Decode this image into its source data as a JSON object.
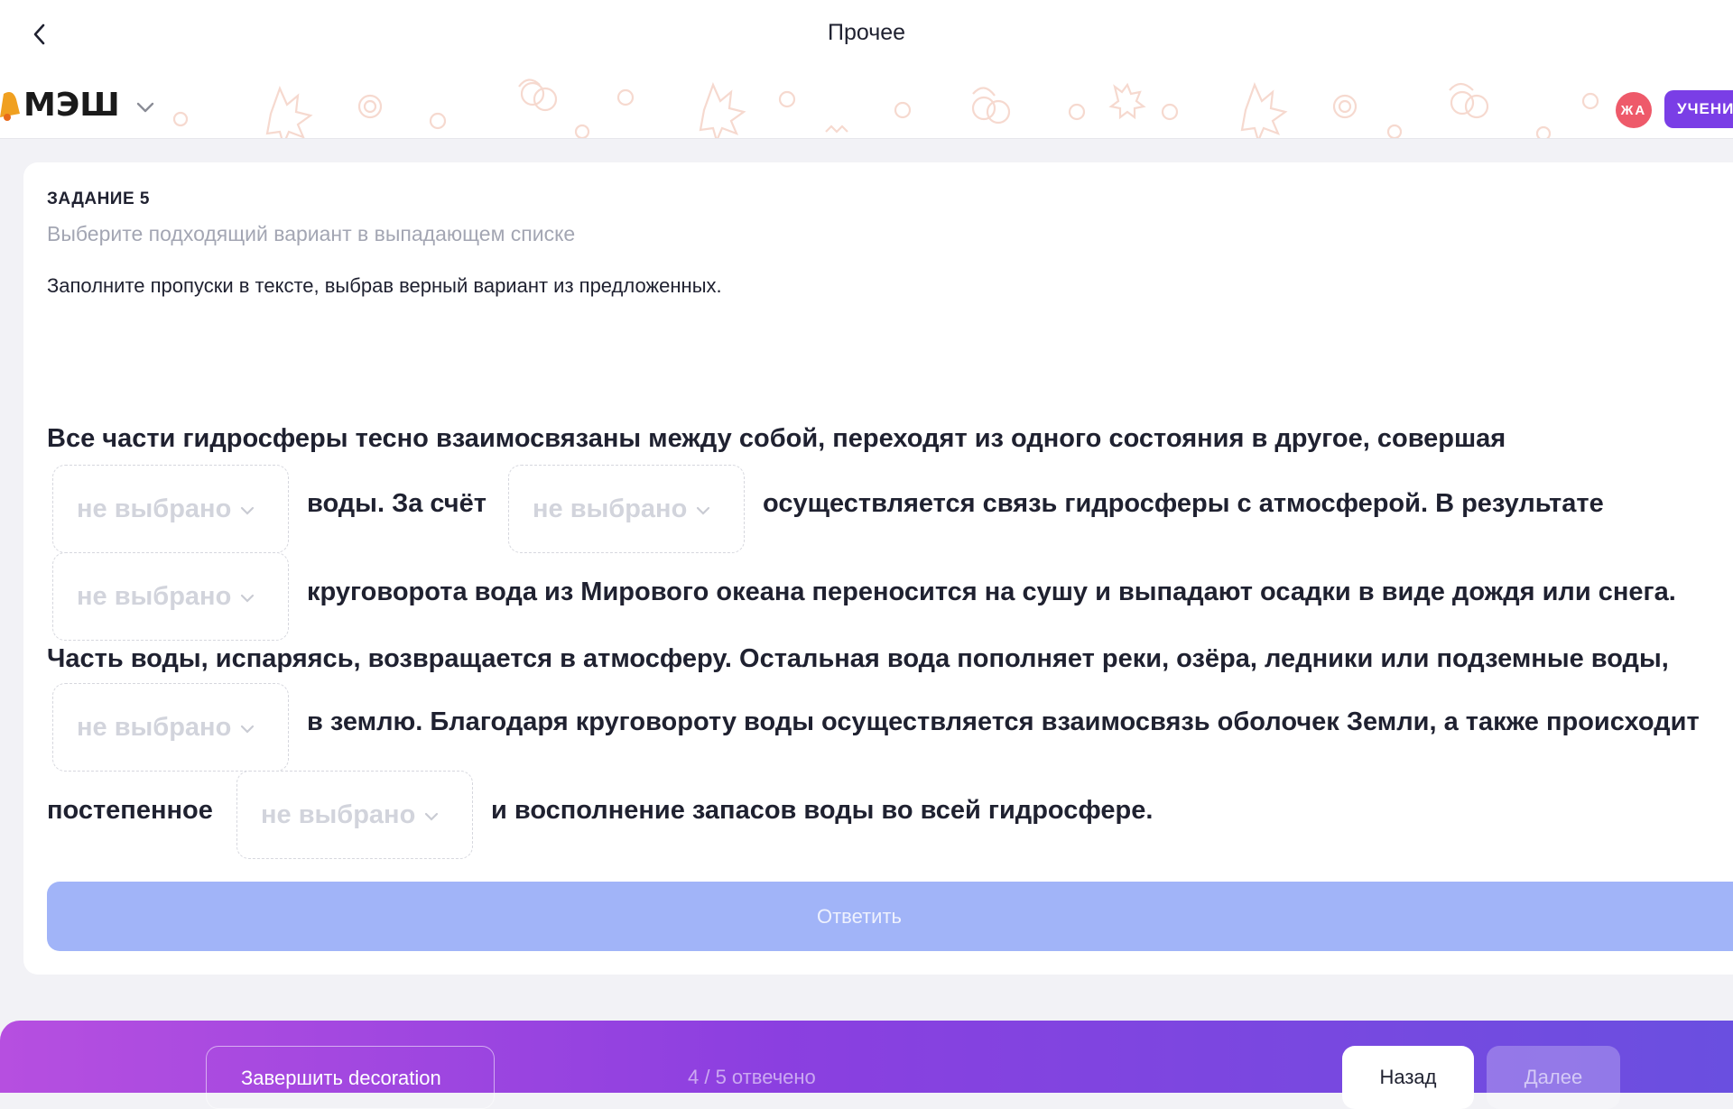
{
  "header": {
    "title": "Прочее"
  },
  "brand": {
    "logo_text": "МЭШ",
    "avatar_initials": "ЖА",
    "role_badge": "УЧЕНИ",
    "accent_color": "#7a3ee6",
    "avatar_color": "#ee5a6a"
  },
  "task": {
    "label": "ЗАДАНИЕ 5",
    "hint": "Выберите подходящий вариант в выпадающем списке",
    "instruction": "Заполните пропуски в тексте, выбрав верный вариант из предложенных.",
    "text": {
      "line1": "Все части гидросферы тесно взаимосвязаны между собой, переходят из одного состояния в другое, совершая",
      "after_blank1": "воды. За счёт",
      "after_blank2": "осуществляется связь гидросферы с атмосферой. В результате",
      "after_blank3": "круговорота вода из Мирового океана переносится на сушу и выпадают осадки в виде дождя или снега.",
      "line4": "Часть воды, испаряясь, возвращается в атмосферу. Остальная вода пополняет реки, озёра, ледники или подземные воды,",
      "after_blank4": "в землю. Благодаря круговороту воды осуществляется взаимосвязь оболочек Земли, а также происходит",
      "before_blank5": "постепенное",
      "after_blank5": "и восполнение запасов воды во всей гидросфере."
    },
    "dropdowns": [
      {
        "selected": "не выбрано"
      },
      {
        "selected": "не выбрано"
      },
      {
        "selected": "не выбрано"
      },
      {
        "selected": "не выбрано"
      },
      {
        "selected": "не выбрано"
      }
    ],
    "submit_label": "Ответить"
  },
  "footer": {
    "finish_label": "Завершить decoration",
    "progress": "4 / 5 отвечено",
    "back_label": "Назад",
    "next_label": "Далее"
  }
}
